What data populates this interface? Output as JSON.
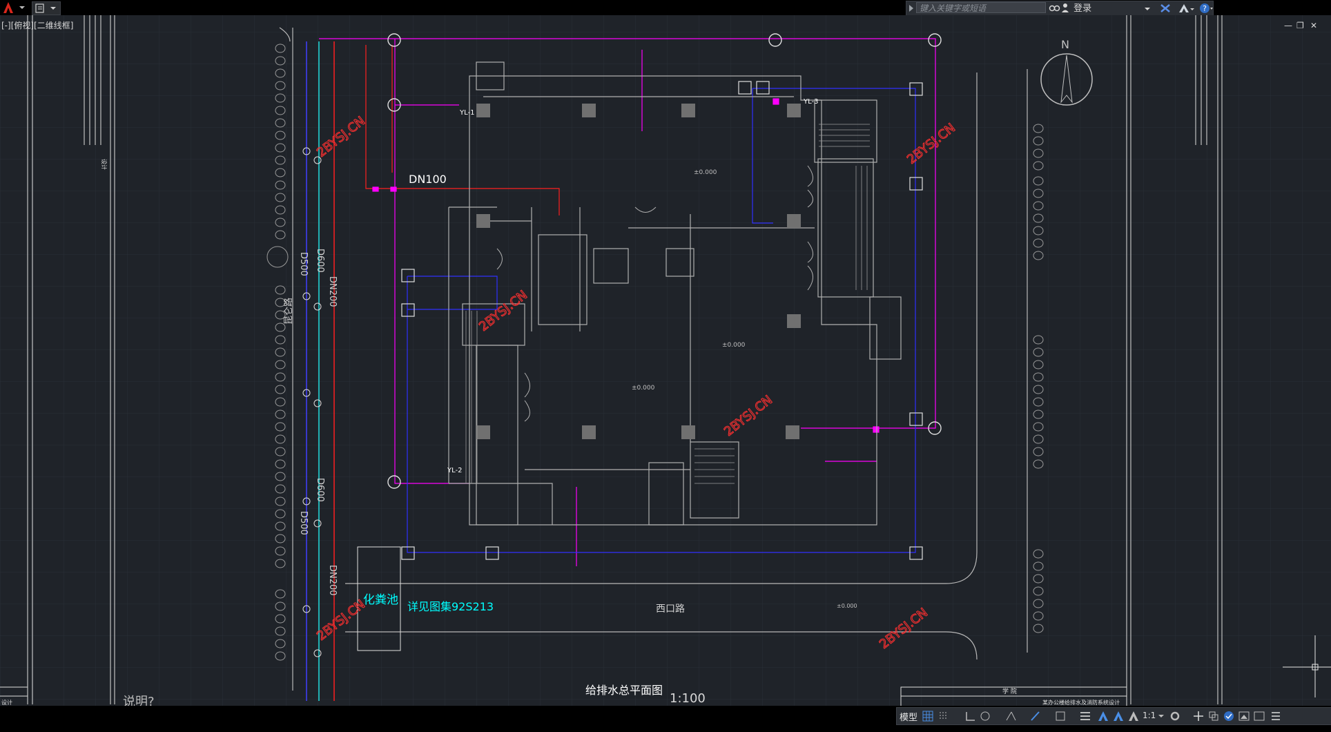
{
  "app": {
    "viewport_label": "[-][俯视][二维线框]",
    "search_placeholder": "键入关键字或短语",
    "login_label": "登录",
    "status_model": "模型",
    "status_scale": "1:1"
  },
  "drawing": {
    "title": "给排水总平面图",
    "scale": "1:100",
    "note_label": "说明?",
    "road_west": "西口路",
    "road_left": "昆仑路",
    "pipe_dn100": "DN100",
    "pipe_d600_upper": "D600",
    "pipe_d600_lower": "D600",
    "pipe_d500_upper": "D500",
    "pipe_d500_lower": "D500",
    "pipe_dn200_upper": "DN200",
    "pipe_dn200_lower": "DN200",
    "septic_tank": "化粪池",
    "septic_note": "详见图集92S213",
    "north": "N",
    "yl1": "YL-1",
    "yl2": "YL-2",
    "yl3": "YL-3",
    "elev_1": "±0.000",
    "elev_2": "±0.000",
    "elev_3": "±0.000",
    "elev_4": "±0.000",
    "watermark": "2BYSJ.CN",
    "tb_school": "学 院",
    "tb_project": "某办公楼给排水及消防系统设计",
    "left_panel_text": "设计",
    "left_bottom_text": "设计"
  },
  "colors": {
    "background": "#1f2329",
    "water_supply": "#ff00ff",
    "fire_line": "#ff2020",
    "drainage": "#2020ff",
    "cyan": "#00ffff",
    "watermark": "#ff3030",
    "walls": "#b0b0b0"
  }
}
